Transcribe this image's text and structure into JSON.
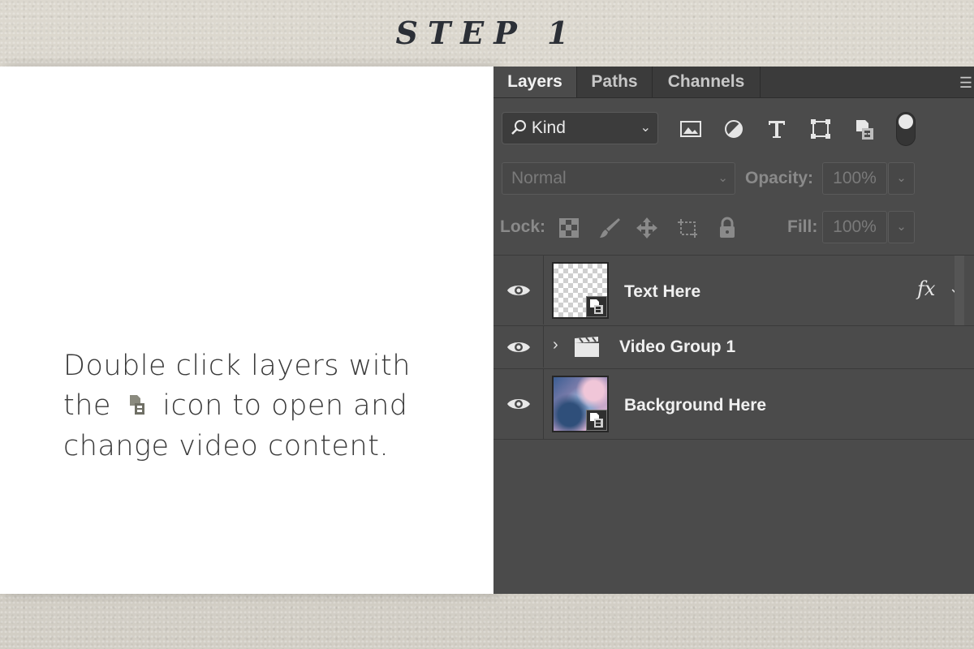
{
  "step_title": "STEP 1",
  "instruction": {
    "line1": "Double click layers with",
    "line2_pre": "the",
    "line2_post": "icon to open and",
    "line3": "change video content."
  },
  "panel": {
    "tabs": [
      "Layers",
      "Paths",
      "Channels"
    ],
    "active_tab": "Layers",
    "filter": {
      "kind_label": "Kind",
      "kind_prefix_icon": "search-icon"
    },
    "filter_icons": [
      "image-icon",
      "adjustment-icon",
      "type-icon",
      "shape-icon",
      "smart-object-icon"
    ],
    "blend_mode": "Normal",
    "opacity_label": "Opacity:",
    "opacity_value": "100%",
    "lock_label": "Lock:",
    "lock_icons": [
      "lock-pixels-icon",
      "lock-brush-icon",
      "lock-move-icon",
      "lock-artboard-icon",
      "lock-all-icon"
    ],
    "fill_label": "Fill:",
    "fill_value": "100%",
    "layers": [
      {
        "name": "Text Here",
        "type": "smart-object",
        "thumbnail": "transparent",
        "fx": "fx"
      },
      {
        "name": "Video Group 1",
        "type": "video-group"
      },
      {
        "name": "Background Here",
        "type": "smart-object",
        "thumbnail": "sky"
      }
    ]
  },
  "colors": {
    "panel_bg": "#4b4b4b",
    "tabbar_bg": "#3b3b3b",
    "card_bg": "#ffffff",
    "paper_bg": "#d9d5cc"
  }
}
